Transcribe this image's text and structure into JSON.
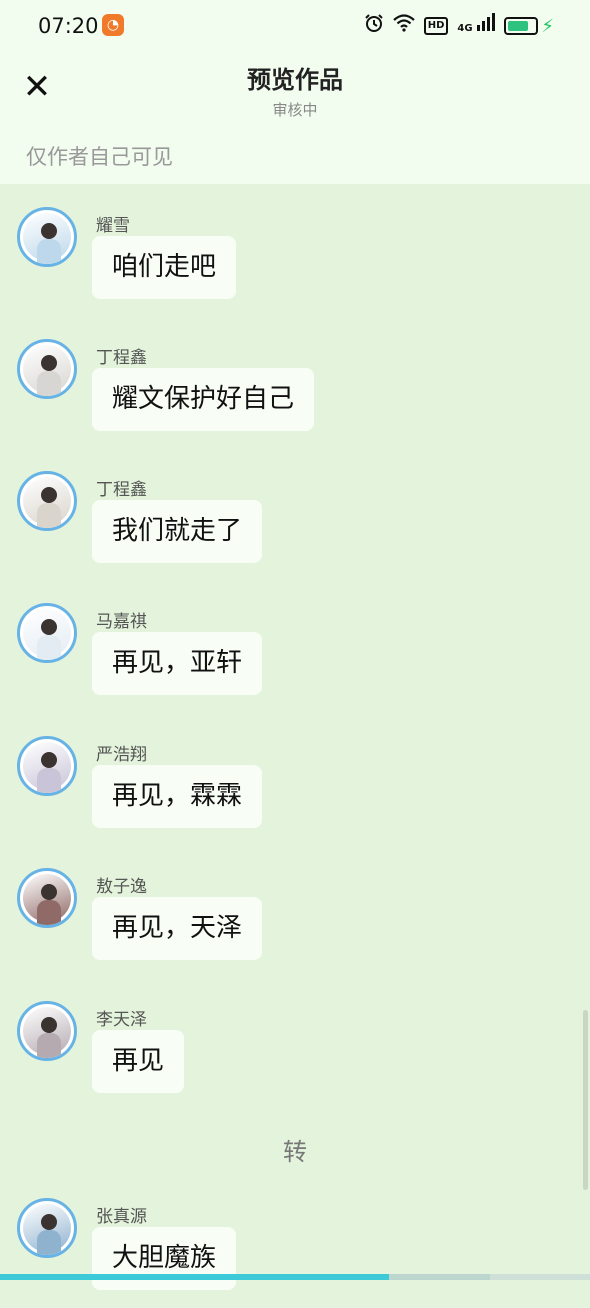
{
  "status_bar": {
    "time": "07:20",
    "app_icon_glyph": "◔",
    "icons": [
      "alarm-icon",
      "wifi-icon",
      "hd-icon",
      "signal-4g-icon",
      "battery-icon",
      "charging-icon"
    ],
    "hd_label": "HD",
    "network_label": "4G",
    "battery_level": 0.85,
    "battery_color": "#2ec27e"
  },
  "header": {
    "close_glyph": "✕",
    "title": "预览作品",
    "subtitle": "审核中",
    "notice": "仅作者自己可见"
  },
  "messages": [
    {
      "name": "耀雪",
      "text": "咱们走吧",
      "avatar_color": "#bcd8ea"
    },
    {
      "name": "丁程鑫",
      "text": "耀文保护好自己",
      "avatar_color": "#d8d6d2"
    },
    {
      "name": "丁程鑫",
      "text": "我们就走了",
      "avatar_color": "#d9d4cc"
    },
    {
      "name": "马嘉祺",
      "text": "再见，亚轩",
      "avatar_color": "#e4ecf3"
    },
    {
      "name": "严浩翔",
      "text": "再见，霖霖",
      "avatar_color": "#c9c4d8"
    },
    {
      "name": "敖子逸",
      "text": "再见，天泽",
      "avatar_color": "#8f6a66"
    },
    {
      "name": "李天泽",
      "text": "再见",
      "avatar_color": "#b4aab0"
    }
  ],
  "separator": "转",
  "last_message": {
    "name": "张真源",
    "text": "大胆魔族",
    "avatar_color": "#8fb2cf"
  },
  "colors": {
    "background": "#e4f4dc",
    "header_bg": "#f2fdf0",
    "bubble_bg": "#f8fdf5",
    "avatar_ring": "#67b3e6",
    "progress": "#3cc9d8"
  },
  "reading_progress": 0.66
}
